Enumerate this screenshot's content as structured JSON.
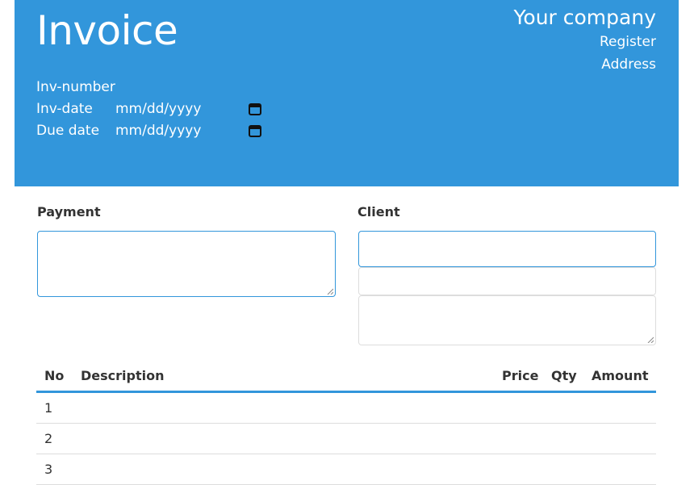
{
  "header": {
    "title": "Invoice",
    "company_name": "Your company",
    "company_register": "Register",
    "company_address": "Address",
    "inv_number_label": "Inv-number",
    "inv_date_label": "Inv-date",
    "inv_date_placeholder": "mm/dd/yyyy",
    "due_date_label": "Due date",
    "due_date_placeholder": "mm/dd/yyyy"
  },
  "payment": {
    "label": "Payment"
  },
  "client": {
    "label": "Client"
  },
  "table": {
    "headers": {
      "no": "No",
      "description": "Description",
      "price": "Price",
      "qty": "Qty",
      "amount": "Amount"
    },
    "rows": [
      {
        "no": "1"
      },
      {
        "no": "2"
      },
      {
        "no": "3"
      }
    ]
  },
  "colors": {
    "accent": "#3296db"
  }
}
